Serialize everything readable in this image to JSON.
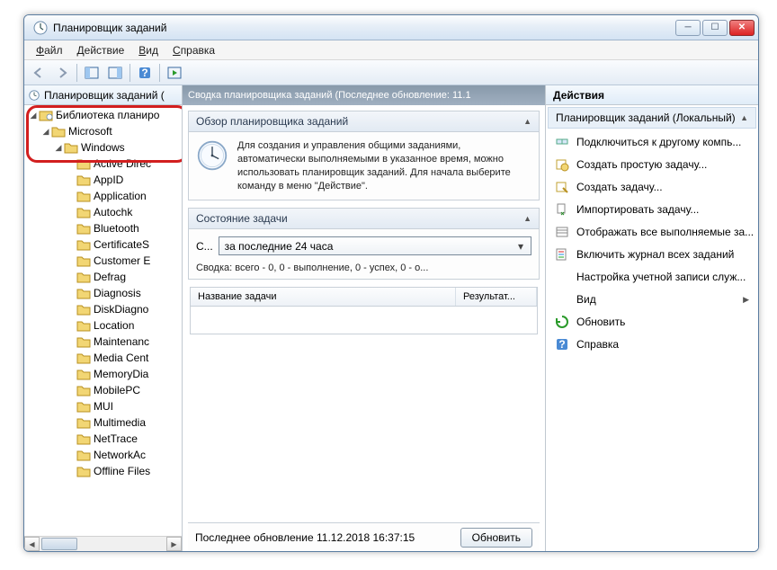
{
  "window": {
    "title": "Планировщик заданий"
  },
  "menu": {
    "file": "Файл",
    "action": "Действие",
    "view": "Вид",
    "help": "Справка"
  },
  "tree": {
    "header": "Планировщик заданий (",
    "root": "Библиотека планиро",
    "microsoft": "Microsoft",
    "windows": "Windows",
    "folders": [
      "Active Direc",
      "AppID",
      "Application",
      "Autochk",
      "Bluetooth",
      "CertificateS",
      "Customer E",
      "Defrag",
      "Diagnosis",
      "DiskDiagno",
      "Location",
      "Maintenanc",
      "Media Cent",
      "MemoryDia",
      "MobilePC",
      "MUI",
      "Multimedia",
      "NetTrace",
      "NetworkAc",
      "Offline Files"
    ]
  },
  "center": {
    "header": "Сводка планировщика заданий (Последнее обновление: 11.1",
    "overview_title": "Обзор планировщика заданий",
    "overview_text": "Для создания и управления общими заданиями, автоматически выполняемыми в указанное время, можно использовать планировщик заданий. Для начала выберите команду в меню \"Действие\".",
    "status_title": "Состояние задачи",
    "status_prefix": "С...",
    "combo_value": "за последние 24 часа",
    "summary": "Сводка: всего - 0, 0 - выполнение, 0 - успех, 0 - о...",
    "col_name": "Название задачи",
    "col_result": "Результат...",
    "footer_text": "Последнее обновление 11.12.2018 16:37:15",
    "refresh_btn": "Обновить"
  },
  "actions": {
    "header": "Действия",
    "subheader": "Планировщик заданий (Локальный)",
    "items": [
      "Подключиться к другому компь...",
      "Создать простую задачу...",
      "Создать задачу...",
      "Импортировать задачу...",
      "Отображать все выполняемые за...",
      "Включить журнал всех заданий",
      "Настройка учетной записи служ...",
      "Вид",
      "Обновить",
      "Справка"
    ]
  }
}
